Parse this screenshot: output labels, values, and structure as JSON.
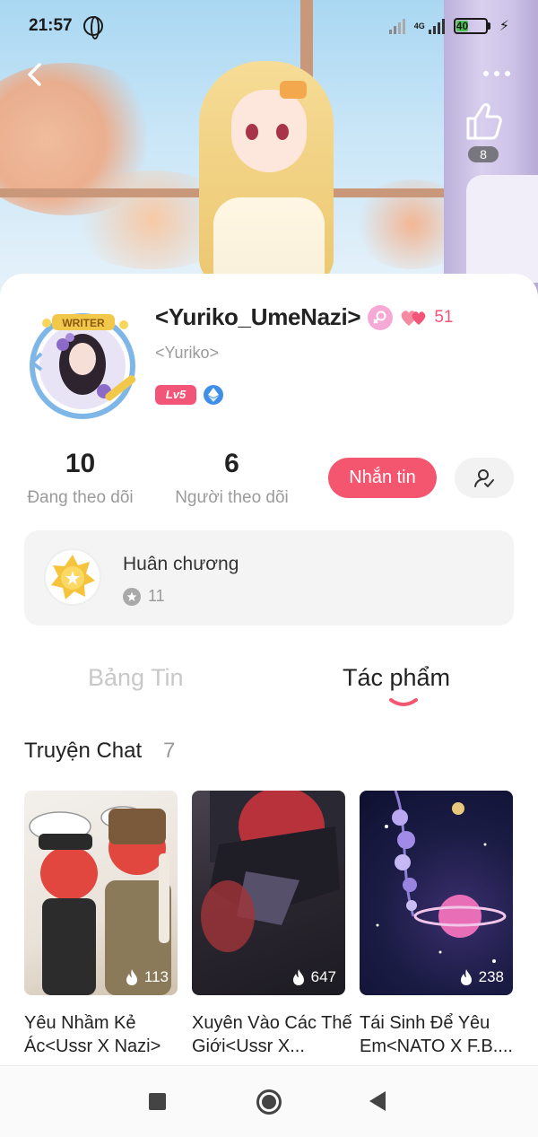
{
  "status_bar": {
    "time": "21:57",
    "network": "4G",
    "battery": "40",
    "charging_icon": "bolt-icon"
  },
  "header": {
    "like_count": "8",
    "icons": [
      "back-arrow-icon",
      "more-dots-icon",
      "thumbs-up-icon"
    ]
  },
  "profile": {
    "username": "<Yuriko_UmeNazi>",
    "handle": "<Yuriko>",
    "hearts": "51",
    "level": "Lv5",
    "avatar_badge": "WRITER",
    "following_count": "10",
    "following_label": "Đang theo dõi",
    "followers_count": "6",
    "followers_label": "Người theo dõi",
    "message_button": "Nhắn tin"
  },
  "medals": {
    "title": "Huân chương",
    "count": "11"
  },
  "tabs": [
    {
      "label": "Bảng Tin",
      "active": false
    },
    {
      "label": "Tác phẩm",
      "active": true
    }
  ],
  "section": {
    "title": "Truyện Chat",
    "count": "7"
  },
  "stories": [
    {
      "title": "Yêu Nhầm Kẻ Ác<Ussr X Nazi>",
      "views": "113"
    },
    {
      "title": "Xuyên Vào Các Thế Giới<Ussr X...",
      "views": "647"
    },
    {
      "title": "Tái Sinh Để Yêu Em<NATO X F.B....",
      "views": "238"
    }
  ],
  "colors": {
    "accent": "#f4566f",
    "heart": "#f25578",
    "level_badge": "#f25578",
    "muted_text": "#9a9a9a"
  }
}
